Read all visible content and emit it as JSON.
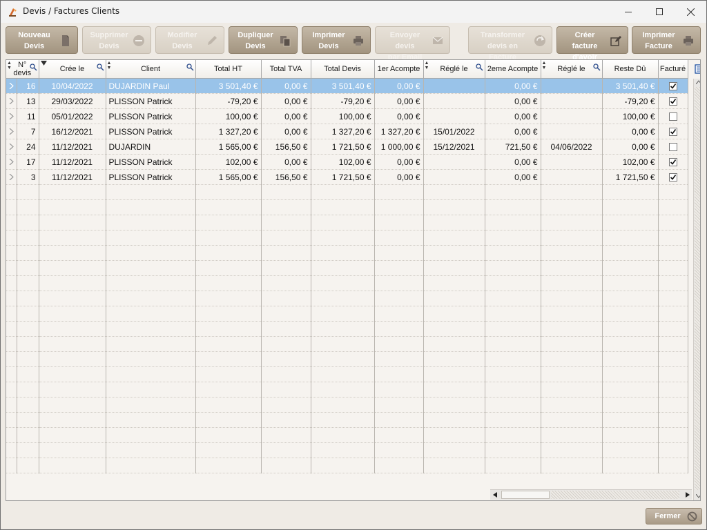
{
  "window": {
    "title": "Devis / Factures Clients"
  },
  "toolbar": {
    "buttons": [
      {
        "label": "Nouveau\nDevis",
        "icon": "new-document-icon",
        "enabled": true
      },
      {
        "label": "Supprimer\nDevis",
        "icon": "minus-circle-icon",
        "enabled": false
      },
      {
        "label": "Modifier\nDevis",
        "icon": "pencil-icon",
        "enabled": false
      },
      {
        "label": "Dupliquer\nDevis",
        "icon": "copy-icon",
        "enabled": true
      },
      {
        "label": "Imprimer\nDevis",
        "icon": "printer-icon",
        "enabled": true
      },
      {
        "label": "Envoyer devis\npar Email",
        "icon": "envelope-icon",
        "enabled": false
      },
      {
        "label": "Transformer\ndevis en Facture",
        "icon": "refresh-icon",
        "enabled": false
      },
      {
        "label": "Créer facture\nd'avoir",
        "icon": "edit-note-icon",
        "enabled": true
      },
      {
        "label": "Imprimer\nFacture",
        "icon": "printer-icon",
        "enabled": true
      }
    ]
  },
  "grid": {
    "columns": [
      "N°\ndevis",
      "Crée le",
      "Client",
      "Total HT",
      "Total TVA",
      "Total Devis",
      "1er Acompte",
      "Réglé le",
      "2eme Acompte",
      "Réglé le",
      "Reste Dû",
      "Facturé"
    ],
    "rows": [
      {
        "num": "16",
        "date": "10/04/2022",
        "client": "DUJARDIN Paul",
        "ht": "3 501,40 €",
        "tva": "0,00 €",
        "total": "3 501,40 €",
        "acompte1": "0,00 €",
        "regle1": "",
        "acompte2": "0,00 €",
        "regle2": "",
        "reste": "3 501,40 €",
        "facture": true,
        "selected": true
      },
      {
        "num": "13",
        "date": "29/03/2022",
        "client": "PLISSON Patrick",
        "ht": "-79,20 €",
        "tva": "0,00 €",
        "total": "-79,20 €",
        "acompte1": "0,00 €",
        "regle1": "",
        "acompte2": "0,00 €",
        "regle2": "",
        "reste": "-79,20 €",
        "facture": true,
        "selected": false
      },
      {
        "num": "11",
        "date": "05/01/2022",
        "client": "PLISSON Patrick",
        "ht": "100,00 €",
        "tva": "0,00 €",
        "total": "100,00 €",
        "acompte1": "0,00 €",
        "regle1": "",
        "acompte2": "0,00 €",
        "regle2": "",
        "reste": "100,00 €",
        "facture": false,
        "selected": false
      },
      {
        "num": "7",
        "date": "16/12/2021",
        "client": "PLISSON Patrick",
        "ht": "1 327,20 €",
        "tva": "0,00 €",
        "total": "1 327,20 €",
        "acompte1": "1 327,20 €",
        "regle1": "15/01/2022",
        "acompte2": "0,00 €",
        "regle2": "",
        "reste": "0,00 €",
        "facture": true,
        "selected": false
      },
      {
        "num": "24",
        "date": "11/12/2021",
        "client": "DUJARDIN",
        "ht": "1 565,00 €",
        "tva": "156,50 €",
        "total": "1 721,50 €",
        "acompte1": "1 000,00 €",
        "regle1": "15/12/2021",
        "acompte2": "721,50 €",
        "regle2": "04/06/2022",
        "reste": "0,00 €",
        "facture": false,
        "selected": false
      },
      {
        "num": "17",
        "date": "11/12/2021",
        "client": "PLISSON Patrick",
        "ht": "102,00 €",
        "tva": "0,00 €",
        "total": "102,00 €",
        "acompte1": "0,00 €",
        "regle1": "",
        "acompte2": "0,00 €",
        "regle2": "",
        "reste": "102,00 €",
        "facture": true,
        "selected": false
      },
      {
        "num": "3",
        "date": "11/12/2021",
        "client": "PLISSON Patrick",
        "ht": "1 565,00 €",
        "tva": "156,50 €",
        "total": "1 721,50 €",
        "acompte1": "0,00 €",
        "regle1": "",
        "acompte2": "0,00 €",
        "regle2": "",
        "reste": "1 721,50 €",
        "facture": true,
        "selected": false
      }
    ]
  },
  "footer": {
    "close_label": "Fermer",
    "close_icon": "forbidden-icon"
  },
  "colors": {
    "button": "#b3a692",
    "selection": "#99c3e9",
    "header": "#f1eee9"
  }
}
